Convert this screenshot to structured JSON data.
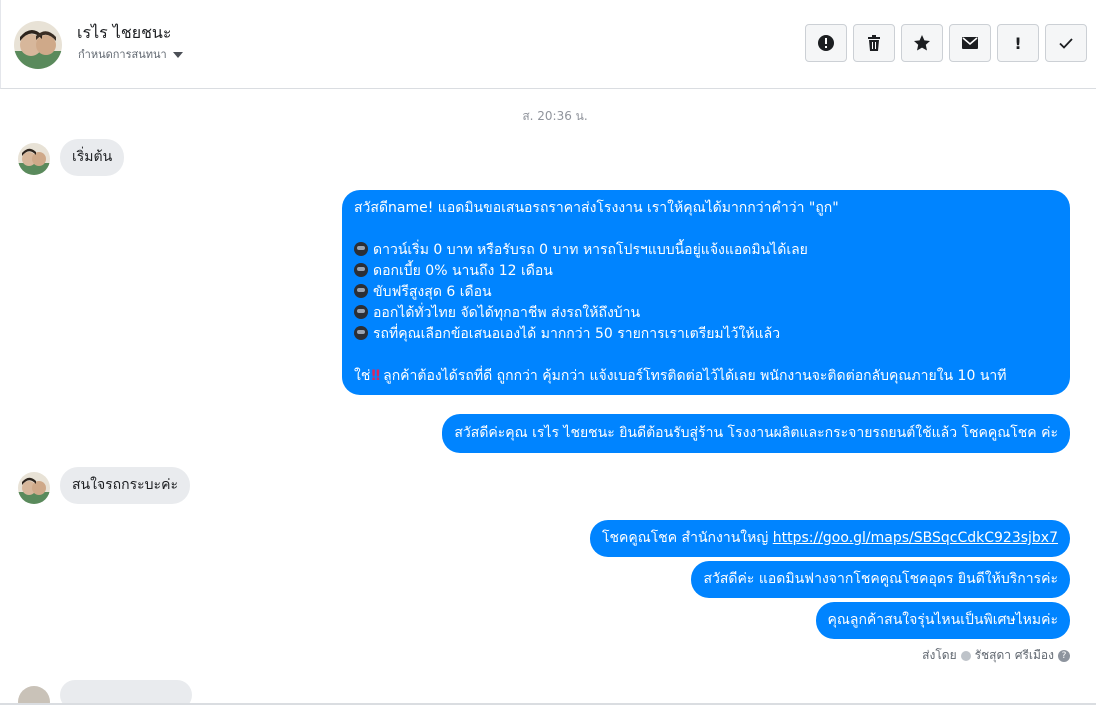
{
  "header": {
    "contact_name": "เรไร ไชยชนะ",
    "assign_label": "กำหนดการสนทนา"
  },
  "toolbar": {
    "buttons": [
      {
        "icon": "alert-circle-icon"
      },
      {
        "icon": "trash-icon"
      },
      {
        "icon": "star-icon"
      },
      {
        "icon": "mail-icon"
      },
      {
        "label": "!"
      },
      {
        "icon": "check-icon"
      }
    ]
  },
  "conversation": {
    "timestamp": "ส. 20:36 น.",
    "messages": [
      {
        "dir": "in",
        "text": "เริ่มต้น"
      },
      {
        "dir": "out",
        "lines": [
          "สวัสดีname! แอดมินขอเสนอรถราคาส่งโรงงาน เราให้คุณได้มากกว่าคำว่า \"ถูก\"",
          "",
          "ดาวน์เริ่ม 0 บาท หรือรับรถ 0 บาท หารถโปรฯแบบนี้อยู่แจ้งแอดมินได้เลย",
          "ดอกเบี้ย 0% นานถึง 12 เดือน",
          "ขับฟรีสูงสุด 6 เดือน",
          "ออกได้ทั่วไทย จัดได้ทุกอาชีพ ส่งรถให้ถึงบ้าน",
          "รถที่คุณเลือกข้อเสนอเองได้ มากกว่า 50 รายการเราเตรียมไว้ให้แล้ว",
          "",
          "ลูกค้าต้องได้รถที่ดี ถูกกว่า คุ้มกว่า แจ้งเบอร์โทรติดต่อไว้ได้เลย พนักงานจะติดต่อกลับคุณภายใน 10 นาที"
        ],
        "last_prefix": "ใช่",
        "last_mark": "!!"
      },
      {
        "dir": "out",
        "text": "สวัสดีค่ะคุณ เรไร ไชยชนะ ยินดีต้อนรับสู่ร้าน โรงงานผลิตและกระจายรถยนต์ใช้แล้ว โชคคูณโชค ค่ะ"
      },
      {
        "dir": "in",
        "text": "สนใจรถกระบะค่ะ"
      },
      {
        "dir": "out",
        "text_prefix": "โชคคูณโชค สำนักงานใหญ่ ",
        "link": "https://goo.gl/maps/SBSqcCdkC923sjbx7"
      },
      {
        "dir": "out",
        "text": "สวัสดีค่ะ แอดมินฟางจากโชคคูณโชคอุดร ยินดีให้บริการค่ะ"
      },
      {
        "dir": "out",
        "text": "คุณลูกค้าสนใจรุ่นไหนเป็นพิเศษไหมค่ะ"
      }
    ],
    "sent_by_label": "ส่งโดย",
    "sent_by_name": "รัชสุดา ศรีเมือง"
  },
  "colors": {
    "outgoing_bubble": "#0084ff",
    "incoming_bubble": "#e9ebee",
    "toolbar_button_bg": "#f5f6f7"
  }
}
